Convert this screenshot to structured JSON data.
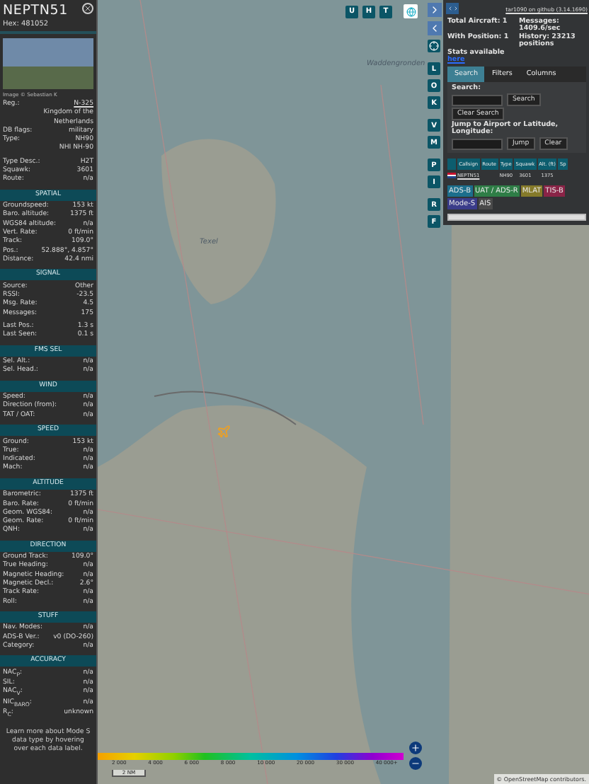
{
  "sidebar": {
    "callsign": "NEPTN51",
    "hex": "Hex: 481052",
    "photo_credit": "Image © Sebastian K",
    "details": [
      [
        {
          "label": "Reg.:",
          "value": "N-325",
          "kind": "link"
        },
        {
          "value": "Kingdom of the Netherlands",
          "kind": "text"
        },
        {
          "label": "DB flags:",
          "value": "military",
          "kind": "text"
        },
        {
          "label": "Type:",
          "value": "NH90",
          "kind": "text"
        },
        {
          "value": "NHI NH-90",
          "kind": "text"
        }
      ],
      [
        {
          "label": "Type Desc.:",
          "value": "H2T",
          "kind": "text"
        },
        {
          "label": "Squawk:",
          "value": "3601",
          "kind": "text"
        },
        {
          "label": "Route:",
          "value": "n/a",
          "kind": "text"
        }
      ]
    ],
    "sections": [
      {
        "title": "SPATIAL",
        "groups": [
          [
            {
              "label": "Groundspeed:",
              "value": "153 kt"
            },
            {
              "label": "Baro. altitude:",
              "value": "1375 ft"
            },
            {
              "label": "WGS84 altitude:",
              "value": "n/a"
            },
            {
              "label": "Vert. Rate:",
              "value": "0 ft/min"
            },
            {
              "label": "Track:",
              "value": "109.0°"
            },
            {
              "label": "Pos.:",
              "value": "52.888°, 4.857°"
            },
            {
              "label": "Distance:",
              "value": "42.4 nmi"
            }
          ]
        ]
      },
      {
        "title": "SIGNAL",
        "groups": [
          [
            {
              "label": "Source:",
              "value": "Other"
            },
            {
              "label": "RSSI:",
              "value": "-23.5"
            },
            {
              "label": "Msg. Rate:",
              "value": "4.5"
            },
            {
              "label": "Messages:",
              "value": "175"
            }
          ],
          [
            {
              "label": "Last Pos.:",
              "value": "1.3 s"
            },
            {
              "label": "Last Seen:",
              "value": "0.1 s"
            }
          ]
        ]
      },
      {
        "title": "FMS SEL",
        "groups": [
          [
            {
              "label": "Sel. Alt.:",
              "value": "n/a"
            },
            {
              "label": "Sel. Head.:",
              "value": "n/a"
            }
          ]
        ]
      },
      {
        "title": "WIND",
        "groups": [
          [
            {
              "label": "Speed:",
              "value": "n/a"
            },
            {
              "label": "Direction (from):",
              "value": "n/a"
            },
            {
              "label": "TAT / OAT:",
              "value": "n/a"
            }
          ]
        ]
      },
      {
        "title": "SPEED",
        "groups": [
          [
            {
              "label": "Ground:",
              "value": "153 kt"
            },
            {
              "label": "True:",
              "value": "n/a"
            },
            {
              "label": "Indicated:",
              "value": "n/a"
            },
            {
              "label": "Mach:",
              "value": "n/a"
            }
          ]
        ]
      },
      {
        "title": "ALTITUDE",
        "groups": [
          [
            {
              "label": "Barometric:",
              "value": "1375 ft"
            },
            {
              "label": "Baro. Rate:",
              "value": "0 ft/min"
            },
            {
              "label": "Geom. WGS84:",
              "value": "n/a"
            },
            {
              "label": "Geom. Rate:",
              "value": "0 ft/min"
            },
            {
              "label": "QNH:",
              "value": "n/a"
            }
          ]
        ]
      },
      {
        "title": "DIRECTION",
        "groups": [
          [
            {
              "label": "Ground Track:",
              "value": "109.0°"
            },
            {
              "label": "True Heading:",
              "value": "n/a"
            },
            {
              "label": "Magnetic Heading:",
              "value": "n/a"
            },
            {
              "label": "Magnetic Decl.:",
              "value": "2.6°"
            },
            {
              "label": "Track Rate:",
              "value": "n/a"
            },
            {
              "label": "Roll:",
              "value": "n/a"
            }
          ]
        ]
      },
      {
        "title": "STUFF",
        "groups": [
          [
            {
              "label": "Nav. Modes:",
              "value": "n/a"
            },
            {
              "label": "ADS-B Ver.:",
              "value": "v0 (DO-260)"
            },
            {
              "label": "Category:",
              "value": "n/a"
            }
          ]
        ]
      },
      {
        "title": "ACCURACY",
        "groups": [
          [
            {
              "label": "NAC$_{P}$:",
              "value": "n/a"
            },
            {
              "label": "SIL:",
              "value": "n/a"
            },
            {
              "label": "NAC$_{V}$:",
              "value": "n/a"
            },
            {
              "label": "NIC$_{BARO}$:",
              "value": "n/a"
            },
            {
              "label": "R$_{C}$:",
              "value": "unknown"
            }
          ]
        ]
      }
    ],
    "footnote": "Learn more about Mode S data type by hovering over each data label."
  },
  "map": {
    "top_buttons": [
      "U",
      "H",
      "T"
    ],
    "side_buttons": [
      [
        "L",
        "O",
        "K"
      ],
      [
        "V",
        "M"
      ],
      [
        "P",
        "I"
      ],
      [
        "R",
        "F"
      ]
    ],
    "labels": [
      {
        "text": "Waddengronden"
      },
      {
        "text": "Texel"
      }
    ],
    "altitude_legend": [
      "2 000",
      "4 000",
      "6 000",
      "8 000",
      "10 000",
      "20 000",
      "30 000",
      "40 000+"
    ],
    "scale": "2 NM",
    "attribution": "© OpenStreetMap contributors."
  },
  "panel": {
    "version_link": "tar1090 on github (3.14.1690)",
    "stats": [
      "Total Aircraft: 1",
      "Messages: 1409.6/sec",
      "With Position: 1",
      "History: 23213 positions"
    ],
    "stats_note": "Stats available",
    "stats_link": "here",
    "tabs": [
      {
        "label": "Search",
        "selected": true
      },
      {
        "label": "Filters",
        "selected": false
      },
      {
        "label": "Columns",
        "selected": false
      }
    ],
    "search_label": "Search:",
    "search_button": "Search",
    "clear_search": "Clear Search",
    "jump_label": "Jump to Airport or Latitude, Longitude:",
    "jump_buttons": [
      "Jump",
      "Clear"
    ],
    "columns": [
      "Callsign",
      "Route",
      "Type",
      "Squawk",
      "Alt. (ft)",
      "Sp"
    ],
    "rows": [
      {
        "callsign": "NEPTN51",
        "type": "NH90",
        "squawk": "3601",
        "altitude": "1375"
      }
    ],
    "legend": [
      {
        "label": "ADS-B",
        "color": "#1c6e8c"
      },
      {
        "label": "UAT / ADS-R",
        "color": "#2e7d46"
      },
      {
        "label": "MLAT",
        "color": "#857a2a"
      },
      {
        "label": "TIS-B",
        "color": "#8a2447"
      },
      {
        "label": "Mode-S",
        "color": "#3a3c8a"
      },
      {
        "label": "AIS",
        "color": "#4a4a4a"
      }
    ]
  }
}
